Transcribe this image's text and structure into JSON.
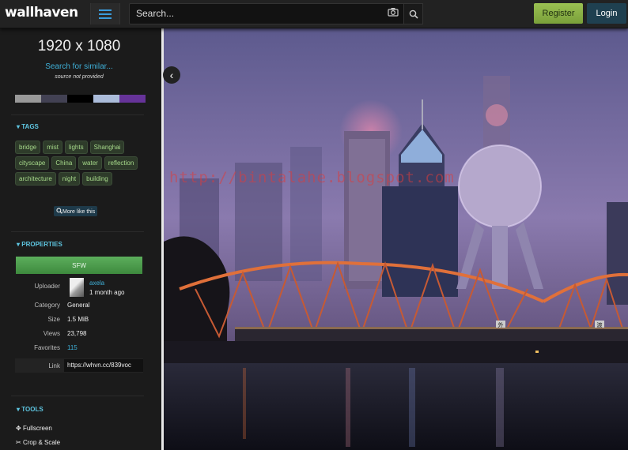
{
  "header": {
    "logo": "wallhaven",
    "search_placeholder": "Search...",
    "register": "Register",
    "login": "Login"
  },
  "wallpaper": {
    "resolution": "1920 x 1080",
    "search_similar": "Search for similar...",
    "source": "source not provided",
    "palette": [
      "#999999",
      "#424153",
      "#000000",
      "#abbcda",
      "#663399"
    ]
  },
  "tags_section": {
    "title": "TAGS",
    "tags": [
      "bridge",
      "mist",
      "lights",
      "Shanghai",
      "cityscape",
      "China",
      "water",
      "reflection",
      "architecture",
      "night",
      "building"
    ],
    "more": "More like this"
  },
  "properties_section": {
    "title": "PROPERTIES",
    "purity": "SFW",
    "uploader_label": "Uploader",
    "uploader_name": "axela",
    "uploader_time": "1 month ago",
    "category_label": "Category",
    "category": "General",
    "size_label": "Size",
    "size": "1.5 MiB",
    "views_label": "Views",
    "views": "23,798",
    "favorites_label": "Favorites",
    "favorites": "115",
    "link_label": "Link",
    "link": "https://whvn.cc/839voc"
  },
  "tools_section": {
    "title": "TOOLS",
    "fullscreen": "Fullscreen",
    "crop": "Crop & Scale"
  },
  "image": {
    "watermark": "http://bintalahe.blogspot.com",
    "sign_left": "外",
    "sign_right": "渡"
  }
}
